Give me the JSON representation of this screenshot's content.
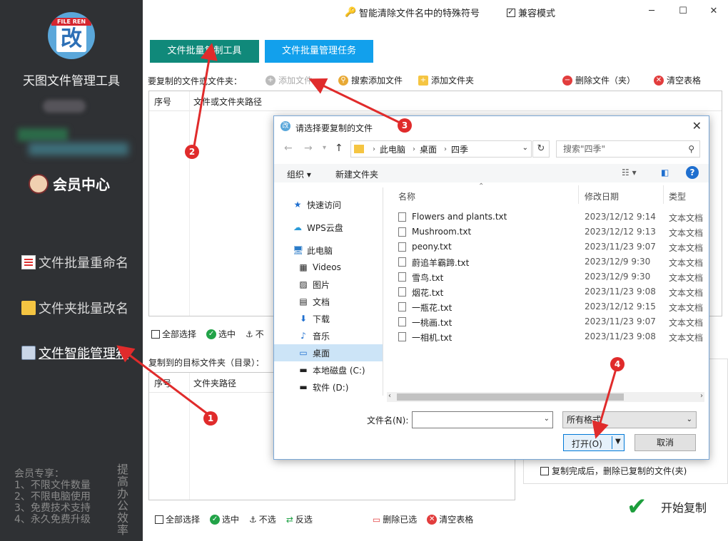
{
  "sidebar": {
    "logo_tag": "FILE REN",
    "logo_char": "改",
    "app_title": "天图文件管理工具",
    "member_center": "会员中心",
    "nav": [
      {
        "label": "文件批量重命名",
        "icon": "document-icon"
      },
      {
        "label": "文件夹批量改名",
        "icon": "folder-icon"
      },
      {
        "label": "文件智能管理箱",
        "icon": "manager-icon"
      }
    ],
    "promo_lines": [
      "会员专享：",
      "1、不限文件数量",
      "2、不限电脑使用",
      "3、免费技术支持",
      "4、永久免费升级"
    ],
    "promo_vertical": "提高办公效率"
  },
  "window": {
    "title": "智能清除文件名中的特殊符号",
    "compat_mode": "兼容模式",
    "compat_checked": true
  },
  "tabs": [
    "文件批量复制工具",
    "文件批量管理任务"
  ],
  "source": {
    "label": "要复制的文件或文件夹：",
    "toolbar": {
      "add_file": "添加文件",
      "search_add": "搜索添加文件",
      "add_folder": "添加文件夹",
      "delete": "删除文件（夹）",
      "clear": "清空表格"
    },
    "columns": [
      "序号",
      "文件或文件夹路径"
    ],
    "bottom": {
      "select_all": "全部选择",
      "select": "选中",
      "unselect": "不"
    }
  },
  "target": {
    "label": "复制到的目标文件夹（目录）：",
    "columns": [
      "序号",
      "文件夹路径"
    ],
    "bottom": {
      "select_all": "全部选择",
      "select": "选中",
      "unselect": "不选",
      "invert": "反选",
      "delete_selected": "删除已选",
      "clear": "清空表格"
    }
  },
  "options": {
    "delete_after_copy": "复制完成后，删除已复制的文件(夹)"
  },
  "start_button": "开始复制",
  "dialog": {
    "title": "请选择要复制的文件",
    "breadcrumb": [
      "此电脑",
      "桌面",
      "四季"
    ],
    "search_placeholder": "搜索\"四季\"",
    "organize": "组织",
    "new_folder": "新建文件夹",
    "nav_items": [
      {
        "label": "快速访问",
        "icon": "star-icon"
      },
      {
        "label": "WPS云盘",
        "icon": "cloud-icon"
      },
      {
        "label": "此电脑",
        "icon": "computer-icon"
      },
      {
        "label": "Videos",
        "icon": "video-icon"
      },
      {
        "label": "图片",
        "icon": "picture-icon"
      },
      {
        "label": "文档",
        "icon": "document-icon"
      },
      {
        "label": "下载",
        "icon": "download-icon"
      },
      {
        "label": "音乐",
        "icon": "music-icon"
      },
      {
        "label": "桌面",
        "icon": "desktop-icon"
      },
      {
        "label": "本地磁盘 (C:)",
        "icon": "disk-icon"
      },
      {
        "label": "软件 (D:)",
        "icon": "drive-icon"
      }
    ],
    "selected_nav": "桌面",
    "columns": [
      "名称",
      "修改日期",
      "类型"
    ],
    "files": [
      {
        "name": "Flowers and plants.txt",
        "date": "2023/12/12 9:14",
        "type": "文本文档"
      },
      {
        "name": "Mushroom.txt",
        "date": "2023/12/12 9:13",
        "type": "文本文档"
      },
      {
        "name": "peony.txt",
        "date": "2023/11/23 9:07",
        "type": "文本文档"
      },
      {
        "name": "蔚追羊霸蹄.txt",
        "date": "2023/12/9 9:30",
        "type": "文本文档"
      },
      {
        "name": "雪鸟.txt",
        "date": "2023/12/9 9:30",
        "type": "文本文档"
      },
      {
        "name": "烟花.txt",
        "date": "2023/11/23 9:08",
        "type": "文本文档"
      },
      {
        "name": "一瓶花.txt",
        "date": "2023/12/12 9:15",
        "type": "文本文档"
      },
      {
        "name": "一桃画.txt",
        "date": "2023/11/23 9:07",
        "type": "文本文档"
      },
      {
        "name": "一相机.txt",
        "date": "2023/11/23 9:08",
        "type": "文本文档"
      }
    ],
    "filename_label": "文件名(N):",
    "filename_value": "",
    "filter": "所有格式",
    "open": "打开(O)",
    "cancel": "取消"
  },
  "annotations": [
    "1",
    "2",
    "3",
    "4"
  ],
  "colors": {
    "sidebar_bg": "#2f3134",
    "tab_green": "#10897a",
    "tab_blue": "#12a0ec",
    "annotation_red": "#e02b2b"
  }
}
